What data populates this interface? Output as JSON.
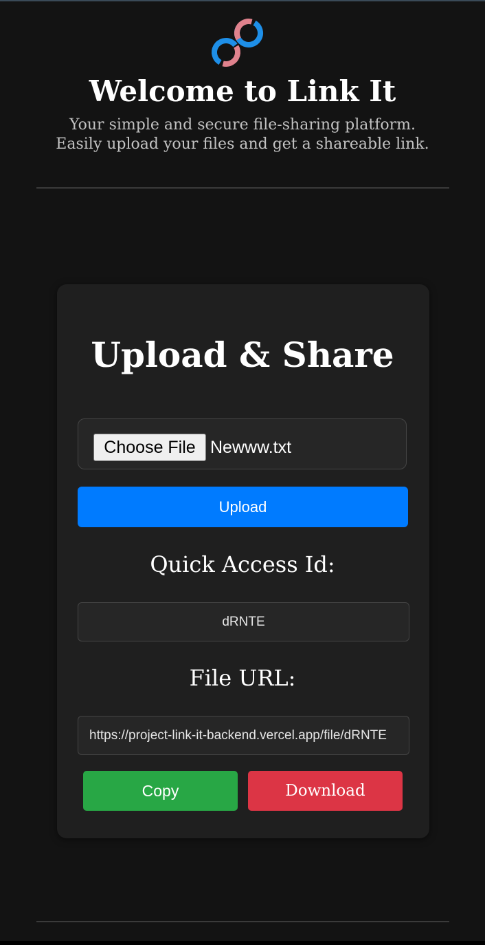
{
  "header": {
    "logo_icon": "infinity-link-icon",
    "title": "Welcome to Link It",
    "subtitle_line1": "Your simple and secure file-sharing platform.",
    "subtitle_line2": "Easily upload your files and get a shareable link."
  },
  "upload_card": {
    "title": "Upload & Share",
    "choose_file_label": "Choose File",
    "file_name": "Newww.txt",
    "upload_label": "Upload",
    "quick_access_label": "Quick Access Id:",
    "quick_access_id": "dRNTE",
    "file_url_label": "File URL:",
    "file_url": "https://project-link-it-backend.vercel.app/file/dRNTE",
    "copy_label": "Copy",
    "download_label": "Download"
  },
  "colors": {
    "background": "#131313",
    "card": "#1f1f1f",
    "upload_button": "#007bff",
    "copy_button": "#28a745",
    "download_button": "#dc3545",
    "logo_blue": "#1e8fe8",
    "logo_pink": "#e0828d"
  }
}
